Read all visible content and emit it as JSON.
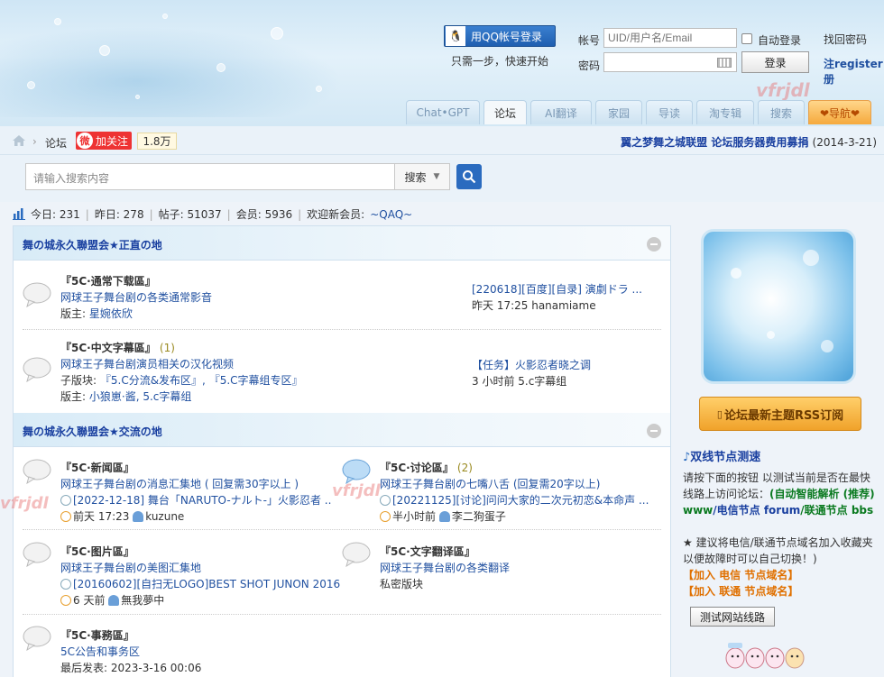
{
  "header": {
    "qq_login_label": "用QQ帐号登录",
    "qq_sub": "只需一步，快速开始",
    "account_label": "帐号",
    "account_placeholder": "UID/用户名/Email",
    "password_label": "密码",
    "auto_login_label": "自动登录",
    "find_password": "找回密码",
    "login_button": "登录",
    "register_link": "注register册",
    "watermark": "vfrjdl"
  },
  "nav_tabs": [
    {
      "label": "Chat•GPT"
    },
    {
      "label": "论坛"
    },
    {
      "label": "AI翻译"
    },
    {
      "label": "家园"
    },
    {
      "label": "导读"
    },
    {
      "label": "淘专辑"
    },
    {
      "label": "搜索"
    },
    {
      "label": "❤导航❤"
    }
  ],
  "breadcrumb": {
    "forum": "论坛",
    "follow_label": "加关注",
    "fans": "1.8万",
    "notice_text": "翼之梦舞之城联盟 论坛服务器费用募捐",
    "notice_date": "(2014-3-21)"
  },
  "search": {
    "placeholder": "请输入搜索内容",
    "type_label": "搜索"
  },
  "stats": {
    "today": "今日: 231",
    "yesterday": "昨日: 278",
    "posts": "帖子: 51037",
    "members": "会员: 5936",
    "welcome": "欢迎新会员:",
    "new_member": "~QAQ~"
  },
  "categories": [
    {
      "title": "舞の城永久聯盟会★正直の地",
      "forums": [
        {
          "name": "『5C·通常下载區』",
          "count": "",
          "desc": "网球王子舞台剧の各类通常影音",
          "line1_label": "版主:",
          "line1_value": "星婉依欣",
          "line2": "",
          "last_title": "[220618][百度][自录] 演劇ドラ ...",
          "last_time": "昨天 17:25 hanamiame"
        },
        {
          "name": "『5C·中文字幕區』",
          "count": "(1)",
          "desc": "网球王子舞台剧演员相关の汉化视频",
          "line1_label": "子版块:",
          "line1_value": "『5.C分流&发布区』, 『5.C字幕组专区』",
          "line2_label": "版主:",
          "line2_value": "小狼崽·酱, 5.c字幕组",
          "last_title": "【任务】火影忍者晓之调",
          "last_time": "3 小时前 5.c字幕组"
        }
      ]
    },
    {
      "title": "舞の城永久聯盟会★交流の地",
      "forums": [
        {
          "name": "『5C·新闻區』",
          "count": "",
          "desc": "网球王子舞台剧の消息汇集地 ( 回复需30字以上 )",
          "last_title": "[2022-12-18] 舞台「NARUTO-ナルト-」火影忍者 ...",
          "last_time": "前天 17:23",
          "last_user": "kuzune"
        },
        {
          "name": "『5C·讨论區』",
          "count": "(2)",
          "desc": "网球王子舞台剧の七嘴八舌 (回复需20字以上)",
          "last_title": "[20221125][讨论]问问大家的二次元初恋&本命声 ...",
          "last_time": "半小时前",
          "last_user": "李二狗蛋子"
        },
        {
          "name": "『5C·图片區』",
          "count": "",
          "desc": "网球王子舞台剧の美图汇集地",
          "last_title": "[20160602][自扫无LOGO]BEST SHOT JUNON 2016 整 ...",
          "last_time": "6 天前",
          "last_user": "無我夢中"
        },
        {
          "name": "『5C·文字翻译區』",
          "count": "",
          "desc": "网球王子舞台剧の各类翻译",
          "line1_value": "私密版块"
        },
        {
          "name": "『5C·事務區』",
          "count": "",
          "desc": "5C公告和事务区",
          "line1_value": "最后发表: 2023-3-16 00:06"
        }
      ]
    }
  ],
  "sidebar": {
    "rss_label": "论坛最新主题RSS订阅",
    "speed_title": "双线节点测速",
    "speed_text_1": "请按下面的按钮 以测试当前是否在最快线路上访问论坛：",
    "speed_auto": "(自动智能解析 (推荐) www",
    "speed_telecom": "/电信节点 forum",
    "speed_unicom": "/联通节点 bbs",
    "speed_note": "★ 建议将电信/联通节点域名加入收藏夹以便故障时可以自己切换！)",
    "join_telecom": "【加入 电信 节点域名】",
    "join_unicom": "【加入 联通 节点域名】",
    "test_button": "测试网站线路"
  }
}
